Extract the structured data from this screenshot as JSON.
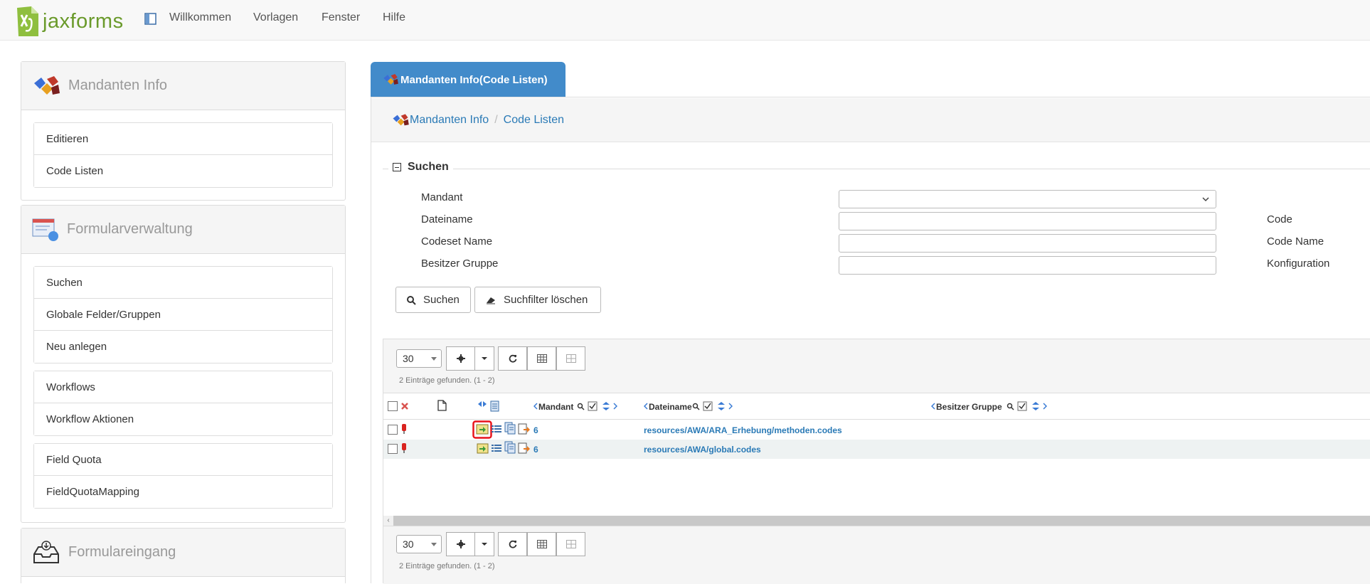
{
  "app": {
    "logo_text": "jaxforms"
  },
  "nav": {
    "items": [
      "Willkommen",
      "Vorlagen",
      "Fenster",
      "Hilfe"
    ]
  },
  "sidebar": {
    "panels": [
      {
        "title": "Mandanten Info",
        "groups": [
          [
            "Editieren",
            "Code Listen"
          ]
        ]
      },
      {
        "title": "Formularverwaltung",
        "groups": [
          [
            "Suchen",
            "Globale Felder/Gruppen",
            "Neu anlegen"
          ],
          [
            "Workflows",
            "Workflow Aktionen"
          ],
          [
            "Field Quota",
            "FieldQuotaMapping"
          ]
        ]
      },
      {
        "title": "Formulareingang",
        "groups": []
      }
    ]
  },
  "tab": {
    "label": "Mandanten Info(Code Listen)"
  },
  "breadcrumb": {
    "items": [
      "Mandanten Info",
      "Code Listen"
    ],
    "separator": "/"
  },
  "search": {
    "legend": "Suchen",
    "fields": {
      "mandant": {
        "label": "Mandant",
        "value": ""
      },
      "dateiname": {
        "label": "Dateiname",
        "value": ""
      },
      "codeset_name": {
        "label": "Codeset Name",
        "value": ""
      },
      "besitzer_gruppe": {
        "label": "Besitzer Gruppe",
        "value": ""
      }
    },
    "right_labels": [
      "Code",
      "Code Name",
      "Konfiguration"
    ],
    "search_button": "Suchen",
    "clear_button": "Suchfilter löschen"
  },
  "grid": {
    "page_size": "30",
    "found_text": "2 Einträge gefunden. (1 - 2)",
    "columns": [
      "Mandant",
      "Dateiname",
      "Besitzer Gruppe"
    ],
    "rows": [
      {
        "mandant": "6",
        "dateiname": "resources/AWA/ARA_Erhebung/methoden.codes",
        "besitzer_gruppe": ""
      },
      {
        "mandant": "6",
        "dateiname": "resources/AWA/global.codes",
        "besitzer_gruppe": ""
      }
    ]
  },
  "colors": {
    "accent": "#428bca",
    "link": "#2a7ab6",
    "logo_green": "#6a9a2b",
    "highlight": "#e8141b"
  }
}
